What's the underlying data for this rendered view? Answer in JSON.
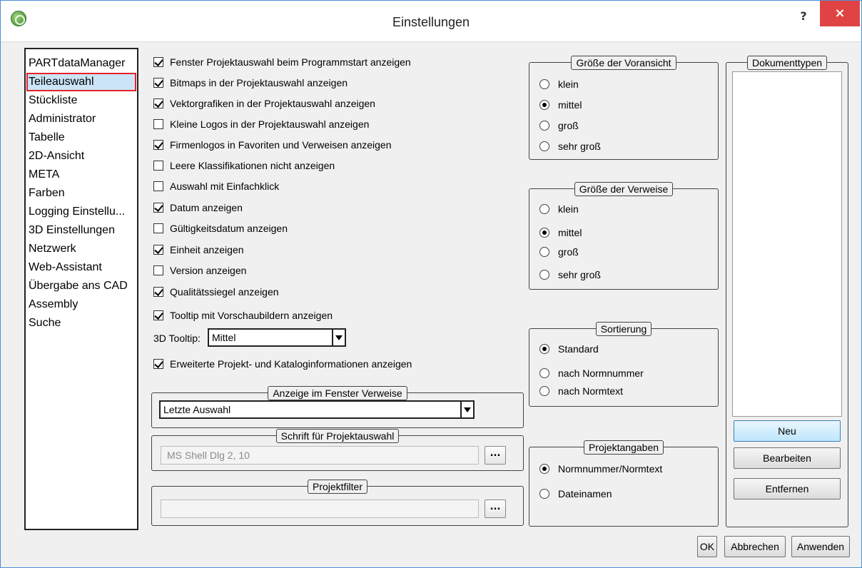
{
  "window": {
    "title": "Einstellungen",
    "help_label": "?",
    "close_label": "×"
  },
  "nav": {
    "items": [
      {
        "label": "PARTdataManager"
      },
      {
        "label": "Teileauswahl",
        "selected": true
      },
      {
        "label": "Stückliste"
      },
      {
        "label": "Administrator"
      },
      {
        "label": "Tabelle"
      },
      {
        "label": "2D-Ansicht"
      },
      {
        "label": "META"
      },
      {
        "label": "Farben"
      },
      {
        "label": "Logging Einstellu..."
      },
      {
        "label": "3D Einstellungen"
      },
      {
        "label": "Netzwerk"
      },
      {
        "label": "Web-Assistant"
      },
      {
        "label": "Übergabe ans CAD"
      },
      {
        "label": "Assembly"
      },
      {
        "label": "Suche"
      }
    ]
  },
  "options": [
    {
      "label": "Fenster Projektauswahl beim Programmstart anzeigen",
      "checked": true
    },
    {
      "label": "Bitmaps in der Projektauswahl anzeigen",
      "checked": true
    },
    {
      "label": "Vektorgrafiken  in der Projektauswahl anzeigen",
      "checked": true
    },
    {
      "label": "Kleine Logos in der Projektauswahl anzeigen",
      "checked": false
    },
    {
      "label": "Firmenlogos in Favoriten und Verweisen anzeigen",
      "checked": true
    },
    {
      "label": "Leere Klassifikationen nicht anzeigen",
      "checked": false
    },
    {
      "label": "Auswahl mit Einfachklick",
      "checked": false
    },
    {
      "label": "Datum anzeigen",
      "checked": true
    },
    {
      "label": "Gültigkeitsdatum anzeigen",
      "checked": false
    },
    {
      "label": "Einheit anzeigen",
      "checked": true
    },
    {
      "label": "Version anzeigen",
      "checked": false
    },
    {
      "label": "Qualitätssiegel anzeigen",
      "checked": true
    },
    {
      "label": "Tooltip mit Vorschaubildern anzeigen",
      "checked": true
    }
  ],
  "tooltip3d": {
    "label": "3D Tooltip:",
    "value": "Mittel"
  },
  "extended_info": {
    "label": "Erweiterte Projekt- und Kataloginformationen anzeigen",
    "checked": true
  },
  "verweise_window": {
    "title": "Anzeige im Fenster Verweise",
    "value": "Letzte Auswahl"
  },
  "font_group": {
    "title": "Schrift für Projektauswahl",
    "value": "MS Shell Dlg 2, 10",
    "button": "..."
  },
  "filter_group": {
    "title": "Projektfilter",
    "value": "",
    "button": "..."
  },
  "preview_size": {
    "title": "Größe der Voransicht",
    "options": [
      {
        "label": "klein",
        "selected": false
      },
      {
        "label": "mittel",
        "selected": true
      },
      {
        "label": "groß",
        "selected": false
      },
      {
        "label": "sehr groß",
        "selected": false
      }
    ]
  },
  "ref_size": {
    "title": "Größe der Verweise",
    "options": [
      {
        "label": "klein",
        "selected": false
      },
      {
        "label": "mittel",
        "selected": true
      },
      {
        "label": "groß",
        "selected": false
      },
      {
        "label": "sehr groß",
        "selected": false
      }
    ]
  },
  "sorting": {
    "title": "Sortierung",
    "options": [
      {
        "label": "Standard",
        "selected": true
      },
      {
        "label": "nach Normnummer",
        "selected": false
      },
      {
        "label": "nach Normtext",
        "selected": false
      }
    ]
  },
  "project_info": {
    "title": "Projektangaben",
    "options": [
      {
        "label": "Normnummer/Normtext",
        "selected": true
      },
      {
        "label": "Dateinamen",
        "selected": false
      }
    ]
  },
  "doctypes": {
    "title": "Dokumenttypen",
    "new_label": "Neu",
    "edit_label": "Bearbeiten",
    "remove_label": "Entfernen"
  },
  "footer": {
    "ok_label": "OK",
    "cancel_label": "Abbrechen",
    "apply_label": "Anwenden"
  }
}
